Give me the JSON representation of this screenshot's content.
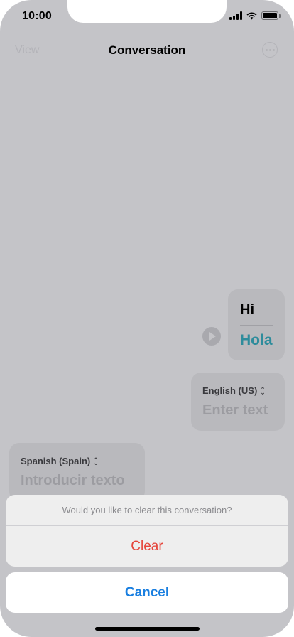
{
  "status_bar": {
    "time": "10:00"
  },
  "nav": {
    "left_label": "View",
    "title": "Conversation",
    "more_icon": "ellipsis-circle-icon"
  },
  "conversation": {
    "bubble": {
      "source": "Hi",
      "translation": "Hola",
      "translation_color": "#2e8c9c"
    },
    "play_icon": "play-icon"
  },
  "inputs": [
    {
      "language": "English (US)",
      "placeholder": "Enter text"
    },
    {
      "language": "Spanish (Spain)",
      "placeholder": "Introducir texto"
    }
  ],
  "action_sheet": {
    "message": "Would you like to clear this conversation?",
    "clear_label": "Clear",
    "cancel_label": "Cancel",
    "destructive_color": "#e5443a",
    "accent_color": "#1a7fe0"
  }
}
